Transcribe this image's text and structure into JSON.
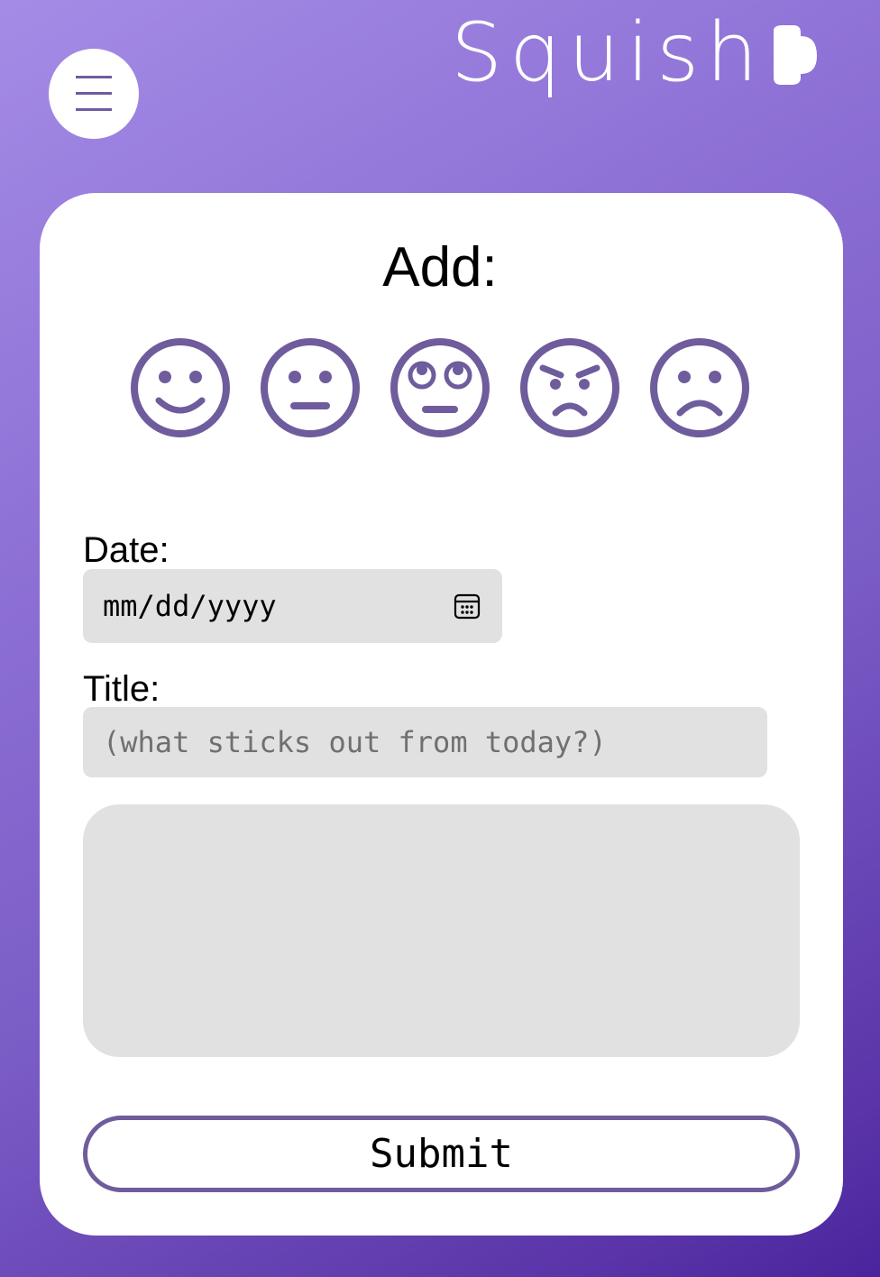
{
  "brand": {
    "name": "Squish",
    "accent": "#6e5c9c"
  },
  "menu": {
    "icon": "hamburger-menu-icon"
  },
  "form": {
    "title": "Add:",
    "moods": [
      {
        "name": "smile-face-icon"
      },
      {
        "name": "neutral-face-icon"
      },
      {
        "name": "eye-roll-face-icon"
      },
      {
        "name": "angry-face-icon"
      },
      {
        "name": "sad-face-icon"
      }
    ],
    "date_label": "Date:",
    "date_placeholder": "mm/dd/yyyy",
    "title_label": "Title:",
    "title_placeholder": "(what sticks out from today?)",
    "notes_value": "",
    "submit_label": "Submit"
  }
}
